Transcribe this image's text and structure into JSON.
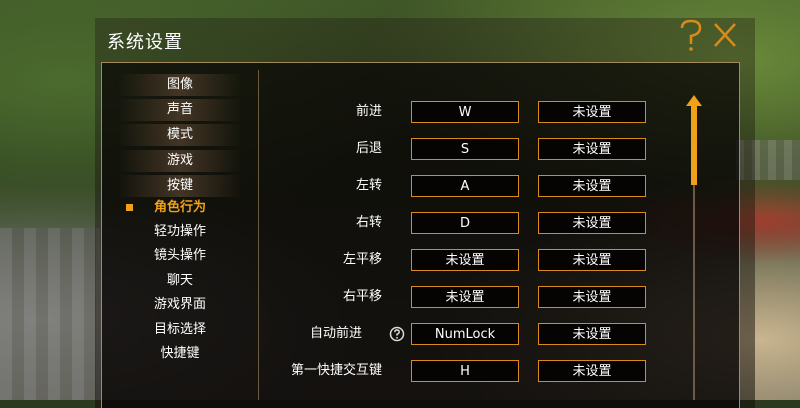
{
  "window": {
    "title": "系统设置"
  },
  "icons": {
    "help": "help-icon",
    "close": "close-icon",
    "info": "info-icon"
  },
  "colors": {
    "accent": "#f0a019",
    "key_border": "#d88a1a",
    "text": "#ffffff",
    "frame_border": "#a58a5e"
  },
  "sidebar": {
    "categories": [
      {
        "label": "图像"
      },
      {
        "label": "声音"
      },
      {
        "label": "模式"
      },
      {
        "label": "游戏"
      },
      {
        "label": "按键"
      }
    ],
    "subitems": [
      {
        "label": "角色行为",
        "active": true
      },
      {
        "label": "轻功操作"
      },
      {
        "label": "镜头操作"
      },
      {
        "label": "聊天"
      },
      {
        "label": "游戏界面"
      },
      {
        "label": "目标选择"
      },
      {
        "label": "快捷键"
      }
    ]
  },
  "bindings": [
    {
      "action": "前进",
      "primary": "W",
      "secondary": "未设置"
    },
    {
      "action": "后退",
      "primary": "S",
      "secondary": "未设置"
    },
    {
      "action": "左转",
      "primary": "A",
      "secondary": "未设置"
    },
    {
      "action": "右转",
      "primary": "D",
      "secondary": "未设置"
    },
    {
      "action": "左平移",
      "primary": "未设置",
      "secondary": "未设置"
    },
    {
      "action": "右平移",
      "primary": "未设置",
      "secondary": "未设置"
    },
    {
      "action": "自动前进",
      "primary": "NumLock",
      "secondary": "未设置",
      "has_info": true
    },
    {
      "action": "第一快捷交互键",
      "primary": "H",
      "secondary": "未设置"
    }
  ]
}
